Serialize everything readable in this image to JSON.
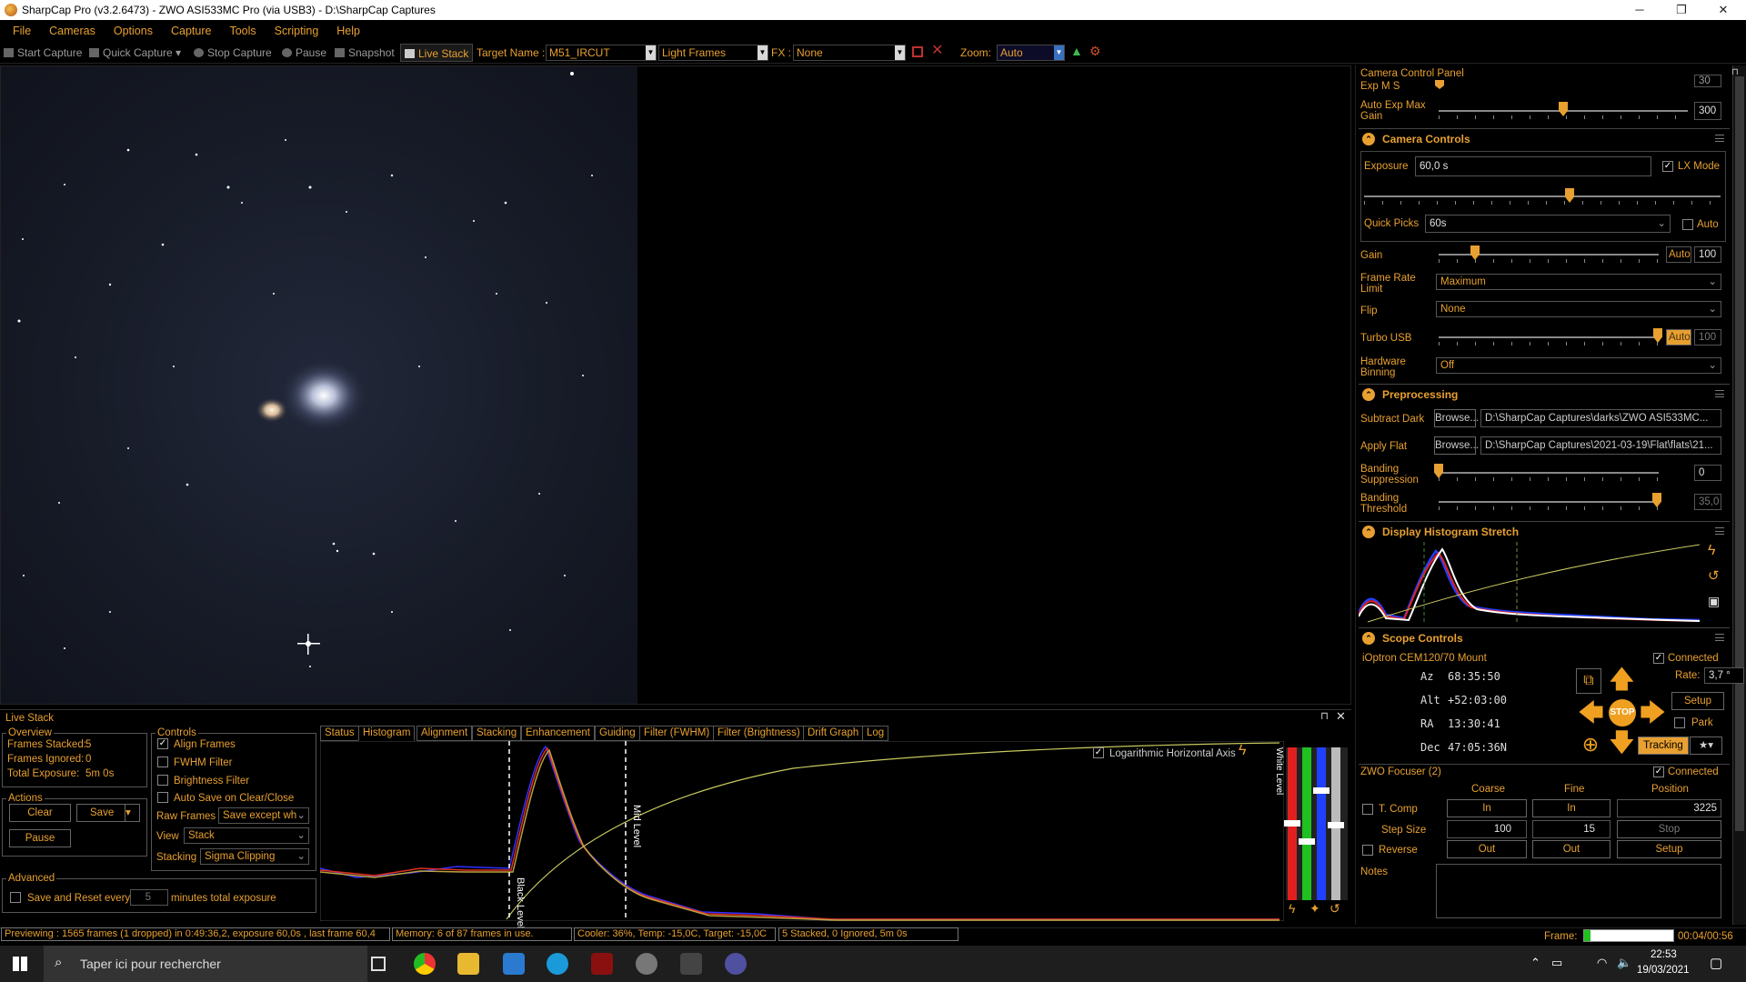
{
  "window": {
    "title": "SharpCap Pro (v3.2.6473) - ZWO ASI533MC Pro (via USB3) - D:\\SharpCap Captures",
    "min": "─",
    "max": "❐",
    "close": "✕"
  },
  "menu": [
    "File",
    "Cameras",
    "Options",
    "Capture",
    "Tools",
    "Scripting",
    "Help"
  ],
  "toolbar": {
    "start_capture": "Start Capture",
    "quick_capture": "Quick Capture",
    "stop_capture": "Stop Capture",
    "pause": "Pause",
    "snapshot": "Snapshot",
    "live_stack": "Live Stack",
    "target_label": "Target Name :",
    "target_value": "M51_IRCUT",
    "frame_type": "Light Frames",
    "fx_label": "FX :",
    "fx_value": "None",
    "zoom_label": "Zoom:",
    "zoom_value": "Auto"
  },
  "ccp": {
    "panel_title": "Camera Control Panel",
    "exp_ms_label": "Exp M S",
    "exp_ms_value": "30",
    "auto_exp_max_gain_label": "Auto Exp Max Gain",
    "auto_exp_max_gain_value": "300",
    "camera_controls": "Camera Controls",
    "exposure_label": "Exposure",
    "exposure_value": "60,0 s",
    "lx_mode": "LX Mode",
    "quick_picks_label": "Quick Picks",
    "quick_picks_value": "60s",
    "quick_auto": "Auto",
    "gain_label": "Gain",
    "gain_auto": "Auto",
    "gain_value": "100",
    "frame_rate_label": "Frame Rate Limit",
    "frame_rate_value": "Maximum",
    "flip_label": "Flip",
    "flip_value": "None",
    "turbo_label": "Turbo USB",
    "turbo_auto": "Auto",
    "turbo_value": "100",
    "binning_label": "Hardware Binning",
    "binning_value": "Off",
    "preprocessing": "Preprocessing",
    "subtract_dark_label": "Subtract Dark",
    "browse": "Browse...",
    "dark_path": "D:\\SharpCap Captures\\darks\\ZWO ASI533MC...",
    "apply_flat_label": "Apply Flat",
    "flat_path": "D:\\SharpCap Captures\\2021-03-19\\Flat\\flats\\21...",
    "banding_supp_label": "Banding Suppression",
    "banding_supp_value": "0",
    "banding_thr_label": "Banding Threshold",
    "banding_thr_value": "35,0",
    "histogram_stretch": "Display Histogram Stretch",
    "scope_controls": "Scope Controls",
    "mount": "iOptron CEM120/70 Mount",
    "connected": "Connected",
    "az_label": "Az",
    "az": "68:35:50",
    "alt_label": "Alt",
    "alt": "+52:03:00",
    "ra_label": "RA",
    "ra": "13:30:41",
    "dec_label": "Dec",
    "dec": "47:05:36N",
    "rate_label": "Rate:",
    "rate_value": "3,7 °",
    "setup": "Setup",
    "park": "Park",
    "stop": "STOP",
    "tracking": "Tracking",
    "focuser": "ZWO Focuser (2)",
    "coarse": "Coarse",
    "fine": "Fine",
    "position": "Position",
    "tcomp": "T. Comp",
    "in": "In",
    "out": "Out",
    "pos_value": "3225",
    "step_size": "Step Size",
    "step_coarse": "100",
    "step_fine": "15",
    "stop_btn": "Stop",
    "reverse": "Reverse",
    "setup2": "Setup",
    "notes": "Notes"
  },
  "live": {
    "panel_title": "Live Stack",
    "overview": "Overview",
    "frames_stacked": "Frames Stacked:",
    "frames_stacked_v": "5",
    "frames_ignored": "Frames Ignored:",
    "frames_ignored_v": "0",
    "total_exposure": "Total Exposure:",
    "total_exposure_v": "5m 0s",
    "actions": "Actions",
    "clear": "Clear",
    "save": "Save",
    "pause": "Pause",
    "controls": "Controls",
    "align": "Align Frames",
    "fwhm": "FWHM Filter",
    "brightness": "Brightness Filter",
    "autosave": "Auto Save on Clear/Close",
    "raw_frames": "Raw Frames",
    "raw_value": "Save except wh",
    "view": "View",
    "view_value": "Stack",
    "stacking": "Stacking",
    "stacking_value": "Sigma Clipping",
    "advanced": "Advanced",
    "save_reset": "Save and Reset every",
    "reset_n": "5",
    "minutes": "minutes total exposure",
    "tabs": [
      "Status",
      "Histogram",
      "Alignment",
      "Stacking",
      "Enhancement",
      "Guiding",
      "Filter (FWHM)",
      "Filter (Brightness)",
      "Drift Graph",
      "Log"
    ],
    "log_axis": "Logarithmic Horizontal Axis",
    "black_level": "Black Level",
    "mid_level": "Mid Level",
    "white_level": "White Level"
  },
  "status": {
    "preview": "Previewing : 1565 frames (1 dropped) in 0:49:36,2, exposure 60,0s , last frame 60,4",
    "memory": "Memory: 6 of 87 frames in use.",
    "cooler": "Cooler: 36%, Temp: -15,0C, Target: -15,0C",
    "stack": "5 Stacked, 0 Ignored, 5m 0s",
    "frame_label": "Frame:",
    "frame_time": "00:04/00:56"
  },
  "taskbar": {
    "search": "Taper ici pour rechercher",
    "time": "22:53",
    "date": "19/03/2021"
  },
  "colors": {
    "accent": "#e8a030",
    "bg": "#000000"
  }
}
